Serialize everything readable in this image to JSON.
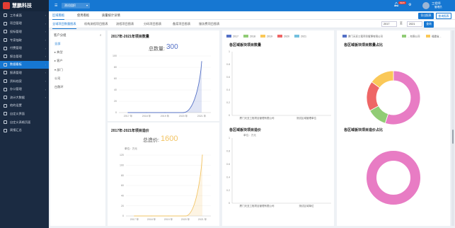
{
  "app": {
    "logo_text": "慧鹏科技"
  },
  "sidebar": {
    "items": [
      {
        "label": "工作桌面"
      },
      {
        "label": "项目管理"
      },
      {
        "label": "投标管理"
      },
      {
        "label": "专家抽取"
      },
      {
        "label": "付费管理"
      },
      {
        "label": "报告管理"
      },
      {
        "label": "数据看板"
      },
      {
        "label": "报表管理"
      },
      {
        "label": "资料档案"
      },
      {
        "label": "办公管理"
      },
      {
        "label": "流计大数据"
      },
      {
        "label": "他的设置"
      },
      {
        "label": "自定义界面"
      },
      {
        "label": "自定义表格页面"
      },
      {
        "label": "周报汇总"
      }
    ]
  },
  "topbar": {
    "org_select": "测试组织",
    "notifications_badge": "NEW",
    "user_name": "工程师",
    "user_sub": "管理员"
  },
  "tabs": [
    {
      "label": "区域看板"
    },
    {
      "label": "使用看板"
    },
    {
      "label": "质量统计详情"
    }
  ],
  "subtabs": [
    {
      "label": "全域项目数量图表"
    },
    {
      "label": "机构流程项目图表"
    },
    {
      "label": "流程项目图表"
    },
    {
      "label": "分码项目图表"
    },
    {
      "label": "备案项目图表"
    },
    {
      "label": "服务费项目图表"
    }
  ],
  "actions": {
    "export_label": "导出报表",
    "search_label": "查询报表",
    "year_from": "2017",
    "to_label": "至",
    "year_to": "2021",
    "query_label": "查询"
  },
  "tree": {
    "header": "客户分组",
    "items": [
      {
        "label": "全部"
      },
      {
        "label": "▸ 典型"
      },
      {
        "label": "▸ 客户"
      },
      {
        "label": "▾ 部门"
      },
      {
        "label": "公司"
      },
      {
        "label": "白散环"
      }
    ]
  },
  "colors": {
    "primary": "#1677d2",
    "sidebar_bg": "#1b2b42",
    "line_blue": "#5470c6",
    "line_orange": "#f2c464",
    "pie_pink": "#e87cc4",
    "pie_green": "#91cc75",
    "pie_red": "#ee6666",
    "pie_yellow": "#fac858"
  },
  "cards": {
    "count_title": "2017年-2021年项目数量",
    "count_total_label": "总数量:",
    "count_total_value": "300",
    "cost_title": "2017年-2021年项目造价",
    "cost_total_label": "总造价:",
    "cost_total_value": "1600",
    "cost_unit": "单位：万元",
    "region_count_title": "各区域板块项目数量",
    "region_cost_title": "各区域板块项目造价",
    "region_cost_unit": "单位：万元",
    "region_count_ratio_title": "各区域板块项目数量占比",
    "region_cost_ratio_title": "各区域板块项目造价占比",
    "pie_legend": [
      "厦门天亚工程项目管理有限公司",
      "…有限公司",
      "福建省..."
    ],
    "bar_legend": [
      "2017",
      "2018",
      "2019",
      "2020",
      "2021"
    ]
  },
  "chart_data": [
    {
      "type": "area",
      "title": "2017年-2021年项目数量",
      "x": [
        "2017 年",
        "2018 年",
        "2019 年",
        "2020 年",
        "2021 年"
      ],
      "values": [
        0,
        0,
        0,
        0,
        90
      ],
      "ylim": [
        0,
        100
      ],
      "yticks": [
        "100",
        "80",
        "60",
        "40",
        "20",
        "0"
      ]
    },
    {
      "type": "area",
      "title": "2017年-2021年项目造价",
      "x": [
        "2017 年",
        "2018 年",
        "2019 年",
        "2020 年",
        "2021 年"
      ],
      "values": [
        0,
        0,
        0,
        0,
        120
      ],
      "ylim": [
        0,
        120
      ],
      "yticks": [
        "120",
        "100",
        "80",
        "60",
        "40",
        "20",
        "0"
      ]
    },
    {
      "type": "bar",
      "title": "各区域板块项目数量",
      "categories": [
        "厦门天亚工程项目管理有限公司",
        "测试区域管理单位"
      ],
      "yticks": [
        "1",
        "0.8",
        "0.6",
        "0.4",
        "0.2",
        "0"
      ],
      "ylim": [
        0,
        1
      ],
      "values": [
        0,
        0
      ]
    },
    {
      "type": "bar",
      "title": "各区域板块项目造价",
      "categories": [
        "厦门天亚工程项目管理有限公司",
        "测试区域单位"
      ],
      "yticks": [
        "1",
        "0.8",
        "0.6",
        "0.4",
        "0.2",
        "0"
      ],
      "ylim": [
        0,
        1
      ],
      "values": [
        0,
        0
      ]
    },
    {
      "type": "pie",
      "title": "各区域板块项目数量占比",
      "values": [
        55,
        12,
        18,
        15
      ]
    },
    {
      "type": "pie",
      "title": "各区域板块项目造价占比",
      "values": [
        100
      ]
    }
  ]
}
